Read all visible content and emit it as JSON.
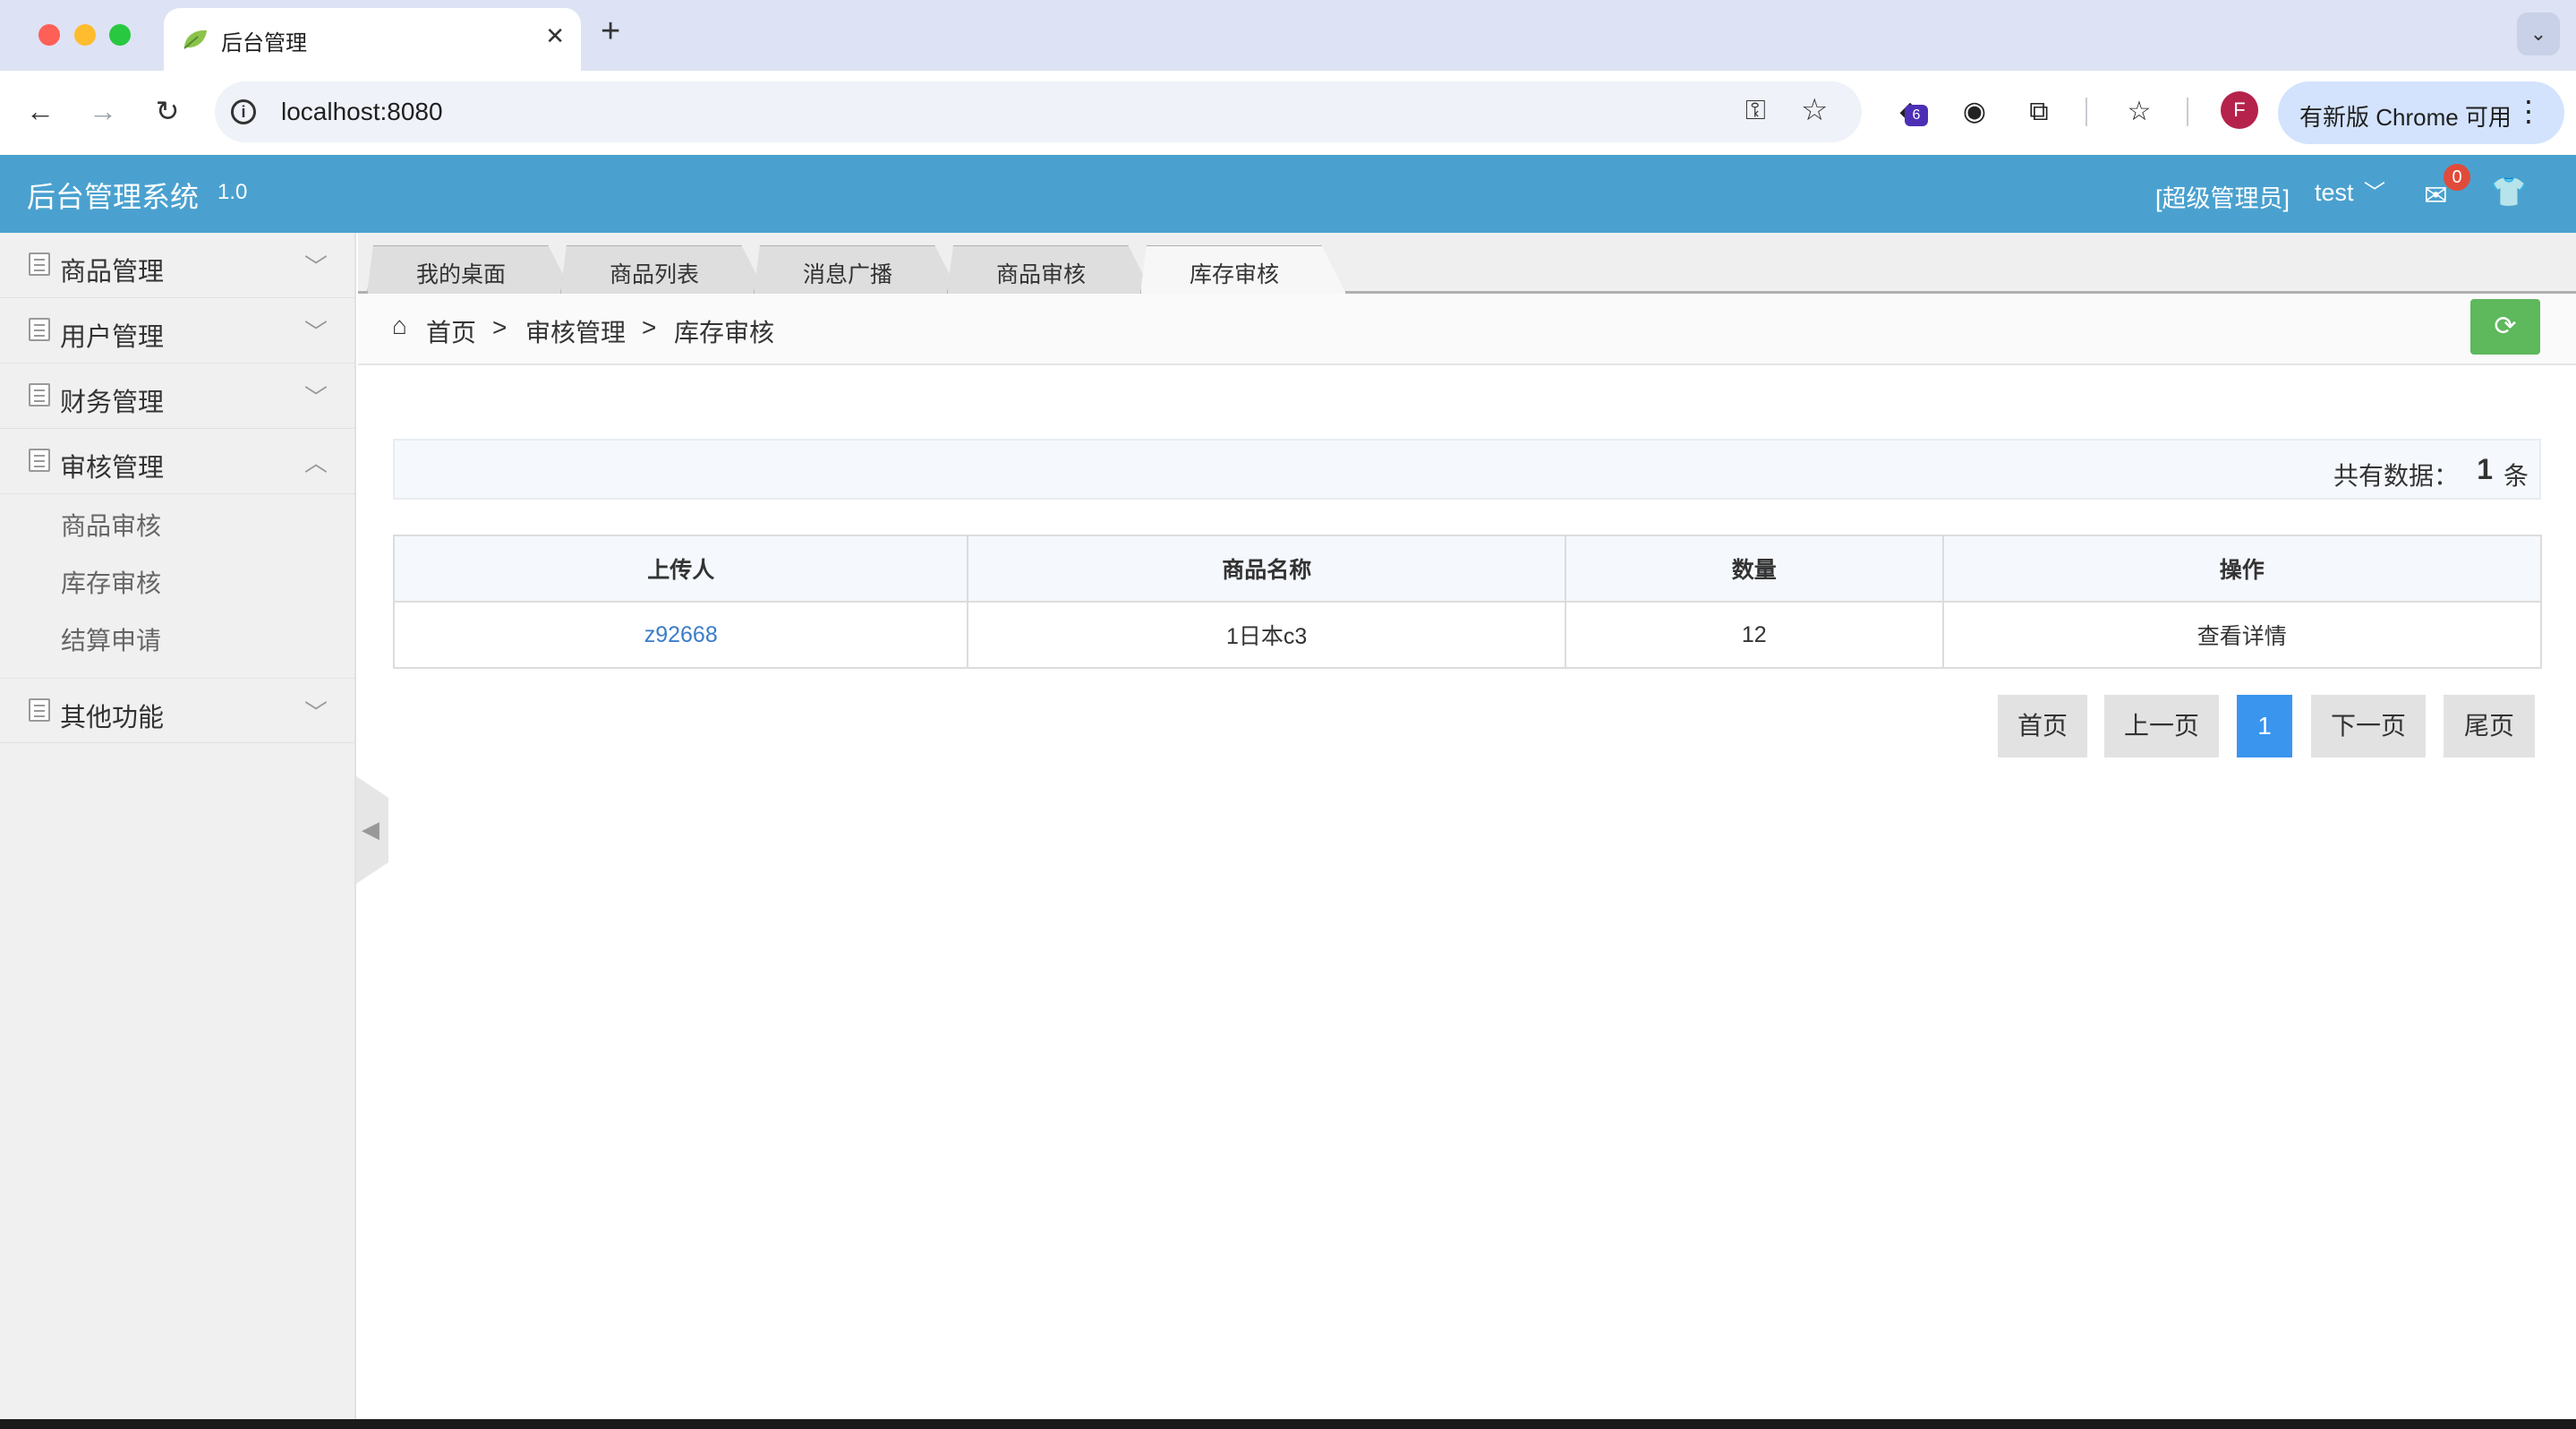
{
  "browser": {
    "tab_title": "后台管理",
    "tab_close": "✕",
    "new_tab": "+",
    "tab_search": "⌄",
    "url": "localhost:8080",
    "extension_badge": "6",
    "profile_initial": "F",
    "update_label": "有新版 Chrome 可用"
  },
  "header": {
    "title": "后台管理系统",
    "version": "1.0",
    "admin_role": "[超级管理员]",
    "admin_user": "test",
    "mail_count": "0"
  },
  "sidebar": {
    "groups": [
      {
        "label": "商品管理",
        "expanded": false
      },
      {
        "label": "用户管理",
        "expanded": false
      },
      {
        "label": "财务管理",
        "expanded": false
      },
      {
        "label": "审核管理",
        "expanded": true
      },
      {
        "label": "其他功能",
        "expanded": false
      }
    ],
    "submenu": [
      "商品审核",
      "库存审核",
      "结算申请"
    ]
  },
  "tabs": [
    {
      "label": "我的桌面",
      "active": false
    },
    {
      "label": "商品列表",
      "active": false
    },
    {
      "label": "消息广播",
      "active": false
    },
    {
      "label": "商品审核",
      "active": false
    },
    {
      "label": "库存审核",
      "active": true
    }
  ],
  "breadcrumb": {
    "items": [
      "首页",
      "审核管理",
      "库存审核"
    ],
    "separator": ">"
  },
  "summary": {
    "label": "共有数据：",
    "count": "1",
    "unit": "条"
  },
  "table": {
    "columns": [
      "上传人",
      "商品名称",
      "数量",
      "操作"
    ],
    "rows": [
      {
        "uploader": "z92668",
        "product": "1日本c3",
        "quantity": "12",
        "action": "查看详情"
      }
    ]
  },
  "pagination": {
    "first": "首页",
    "prev": "上一页",
    "current": "1",
    "next": "下一页",
    "last": "尾页"
  },
  "colors": {
    "header_bg": "#4aa1cf",
    "refresh_btn": "#5eb85c",
    "current_page": "#3a95ef",
    "link": "#3a7cc8"
  }
}
